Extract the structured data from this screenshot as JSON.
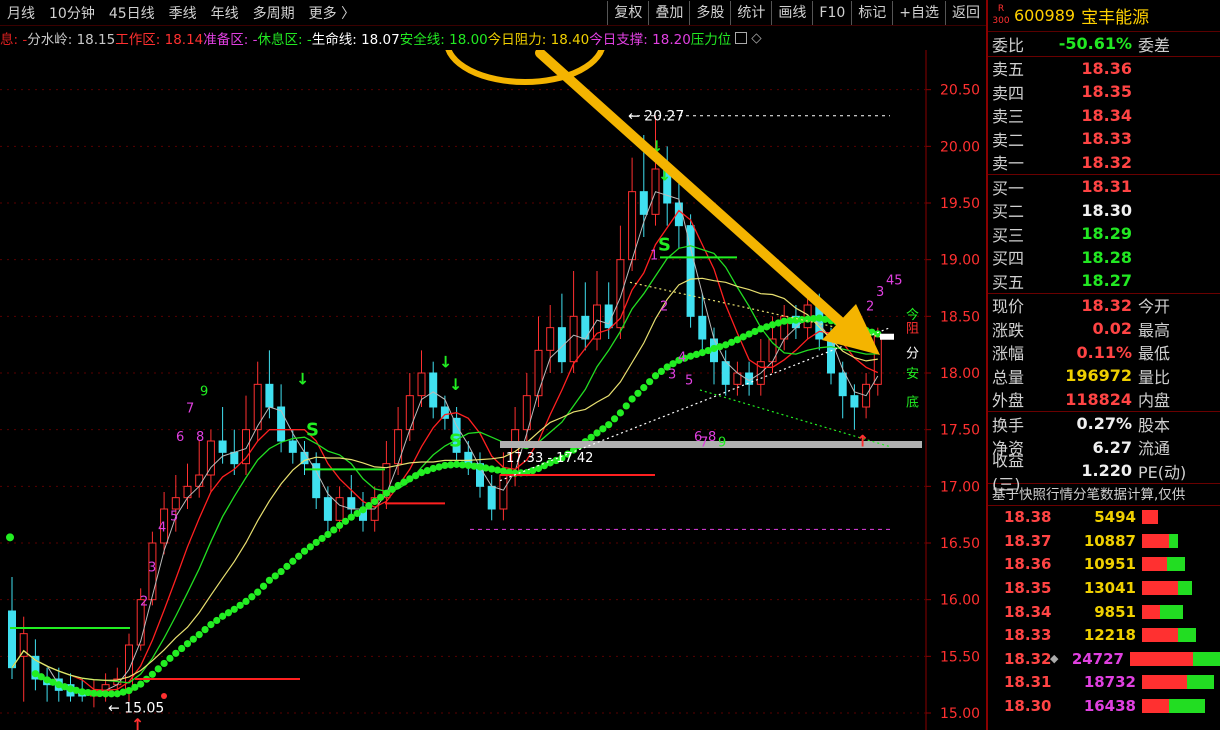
{
  "toolbar": {
    "periods": [
      "月线",
      "10分钟",
      "45日线",
      "季线",
      "年线",
      "多周期",
      "更多 〉"
    ],
    "tools": [
      "复权",
      "叠加",
      "多股",
      "统计",
      "画线",
      "F10",
      "标记",
      "+自选",
      "返回"
    ]
  },
  "indicators": [
    {
      "label": "息:",
      "value": "-",
      "color": "#dd2020"
    },
    {
      "label": "分水岭:",
      "value": "18.15",
      "color": "#c8c8c8"
    },
    {
      "label": "工作区:",
      "value": "18.14",
      "color": "#ff3030"
    },
    {
      "label": "准备区:",
      "value": "-",
      "color": "#e040e0"
    },
    {
      "label": "休息区:",
      "value": "-",
      "color": "#22e822"
    },
    {
      "label": "生命线:",
      "value": "18.07",
      "color": "#ffffff"
    },
    {
      "label": "安全线:",
      "value": "18.00",
      "color": "#22e822"
    },
    {
      "label": "今日阻力:",
      "value": "18.40",
      "color": "#f0d000"
    },
    {
      "label": "今日支撑:",
      "value": "18.20",
      "color": "#e040e0"
    },
    {
      "label": "压力位",
      "value": "",
      "color": "#22e822"
    }
  ],
  "chart_data": {
    "type": "candlestick",
    "ylim": [
      14.85,
      20.85
    ],
    "y_ticks": [
      "20.50",
      "20.00",
      "19.50",
      "19.00",
      "18.50",
      "18.00",
      "17.50",
      "17.00",
      "16.50",
      "16.00",
      "15.50",
      "15.00"
    ],
    "annotations": {
      "high": "20.27",
      "low": "15.05",
      "range": "17.33 - 17.42",
      "side_labels": [
        "今",
        "阻",
        "分",
        "安",
        "底"
      ]
    },
    "candles": [
      [
        15.9,
        15.4,
        16.2,
        15.3
      ],
      [
        15.5,
        15.7,
        15.85,
        15.1
      ],
      [
        15.5,
        15.3,
        15.65,
        15.2
      ],
      [
        15.3,
        15.25,
        15.4,
        15.1
      ],
      [
        15.3,
        15.2,
        15.4,
        15.1
      ],
      [
        15.25,
        15.15,
        15.35,
        15.1
      ],
      [
        15.2,
        15.15,
        15.3,
        15.1
      ],
      [
        15.15,
        15.2,
        15.3,
        15.05
      ],
      [
        15.2,
        15.25,
        15.35,
        15.1
      ],
      [
        15.25,
        15.3,
        15.4,
        15.15
      ],
      [
        15.2,
        15.6,
        15.7,
        15.1
      ],
      [
        15.6,
        16.0,
        16.1,
        15.55
      ],
      [
        16.0,
        16.5,
        16.6,
        15.95
      ],
      [
        16.5,
        16.8,
        16.95,
        16.4
      ],
      [
        16.8,
        16.9,
        17.1,
        16.6
      ],
      [
        16.9,
        17.0,
        17.2,
        16.8
      ],
      [
        17.0,
        17.1,
        17.4,
        16.9
      ],
      [
        17.1,
        17.4,
        17.5,
        16.95
      ],
      [
        17.4,
        17.3,
        17.7,
        17.2
      ],
      [
        17.3,
        17.2,
        17.5,
        17.1
      ],
      [
        17.2,
        17.5,
        17.8,
        17.1
      ],
      [
        17.5,
        17.9,
        18.1,
        17.4
      ],
      [
        17.9,
        17.7,
        18.2,
        17.6
      ],
      [
        17.7,
        17.4,
        17.9,
        17.3
      ],
      [
        17.4,
        17.3,
        17.5,
        17.2
      ],
      [
        17.3,
        17.2,
        17.4,
        17.1
      ],
      [
        17.2,
        16.9,
        17.3,
        16.8
      ],
      [
        16.9,
        16.7,
        17.0,
        16.6
      ],
      [
        16.7,
        16.9,
        17.0,
        16.6
      ],
      [
        16.9,
        16.8,
        17.1,
        16.7
      ],
      [
        16.8,
        16.7,
        16.95,
        16.6
      ],
      [
        16.7,
        16.9,
        17.0,
        16.6
      ],
      [
        16.9,
        17.2,
        17.4,
        16.8
      ],
      [
        17.2,
        17.5,
        17.7,
        17.1
      ],
      [
        17.5,
        17.8,
        18.0,
        17.4
      ],
      [
        17.8,
        18.0,
        18.2,
        17.7
      ],
      [
        18.0,
        17.7,
        18.1,
        17.6
      ],
      [
        17.7,
        17.6,
        17.8,
        17.5
      ],
      [
        17.6,
        17.3,
        17.7,
        17.2
      ],
      [
        17.3,
        17.2,
        17.4,
        17.1
      ],
      [
        17.2,
        17.0,
        17.3,
        16.9
      ],
      [
        17.0,
        16.8,
        17.1,
        16.7
      ],
      [
        16.8,
        17.1,
        17.3,
        16.7
      ],
      [
        17.1,
        17.5,
        17.7,
        17.0
      ],
      [
        17.5,
        17.8,
        18.0,
        17.4
      ],
      [
        17.8,
        18.2,
        18.5,
        17.7
      ],
      [
        18.2,
        18.4,
        18.6,
        18.0
      ],
      [
        18.4,
        18.1,
        18.7,
        18.0
      ],
      [
        18.1,
        18.5,
        18.9,
        18.0
      ],
      [
        18.5,
        18.3,
        18.8,
        18.2
      ],
      [
        18.3,
        18.6,
        18.9,
        18.2
      ],
      [
        18.6,
        18.4,
        18.8,
        18.3
      ],
      [
        18.4,
        19.0,
        19.3,
        18.3
      ],
      [
        19.0,
        19.6,
        19.9,
        18.9
      ],
      [
        19.6,
        19.4,
        20.1,
        19.2
      ],
      [
        19.4,
        19.8,
        20.27,
        19.3
      ],
      [
        19.8,
        19.5,
        20.0,
        19.3
      ],
      [
        19.5,
        19.3,
        19.7,
        19.1
      ],
      [
        19.3,
        18.5,
        19.4,
        18.4
      ],
      [
        18.5,
        18.3,
        18.7,
        18.2
      ],
      [
        18.3,
        18.1,
        18.4,
        17.9
      ],
      [
        18.1,
        17.9,
        18.2,
        17.8
      ],
      [
        17.9,
        18.0,
        18.1,
        17.8
      ],
      [
        18.0,
        17.9,
        18.1,
        17.8
      ],
      [
        17.9,
        18.1,
        18.3,
        17.8
      ],
      [
        18.1,
        18.3,
        18.5,
        18.0
      ],
      [
        18.3,
        18.5,
        18.6,
        18.2
      ],
      [
        18.5,
        18.4,
        18.6,
        18.3
      ],
      [
        18.4,
        18.6,
        18.7,
        18.3
      ],
      [
        18.6,
        18.3,
        18.7,
        18.2
      ],
      [
        18.3,
        18.0,
        18.4,
        17.9
      ],
      [
        18.0,
        17.8,
        18.1,
        17.6
      ],
      [
        17.8,
        17.7,
        17.9,
        17.5
      ],
      [
        17.7,
        17.9,
        18.0,
        17.6
      ],
      [
        17.9,
        18.32,
        18.4,
        17.8
      ]
    ]
  },
  "quote": {
    "header": {
      "r_label": "R",
      "index_label": "300",
      "code": "600989",
      "name": "宝丰能源"
    },
    "ratio": {
      "label": "委比",
      "value": "-50.61%",
      "label2": "委差"
    },
    "asks": [
      {
        "label": "卖五",
        "price": "18.36"
      },
      {
        "label": "卖四",
        "price": "18.35"
      },
      {
        "label": "卖三",
        "price": "18.34"
      },
      {
        "label": "卖二",
        "price": "18.33"
      },
      {
        "label": "卖一",
        "price": "18.32"
      }
    ],
    "bids": [
      {
        "label": "买一",
        "price": "18.31",
        "color": "#ff4444"
      },
      {
        "label": "买二",
        "price": "18.30",
        "color": "#f0f0f0"
      },
      {
        "label": "买三",
        "price": "18.29",
        "color": "#22e822"
      },
      {
        "label": "买四",
        "price": "18.28",
        "color": "#22e822"
      },
      {
        "label": "买五",
        "price": "18.27",
        "color": "#22e822"
      }
    ],
    "stats": [
      {
        "label": "现价",
        "value": "18.32",
        "color": "#ff4444",
        "label2": "今开"
      },
      {
        "label": "涨跌",
        "value": "0.02",
        "color": "#ff4444",
        "label2": "最高"
      },
      {
        "label": "涨幅",
        "value": "0.11%",
        "color": "#ff4444",
        "label2": "最低"
      },
      {
        "label": "总量",
        "value": "196972",
        "color": "#f0d000",
        "label2": "量比"
      },
      {
        "label": "外盘",
        "value": "118824",
        "color": "#ff4444",
        "label2": "内盘"
      }
    ],
    "stats2": [
      {
        "label": "换手",
        "value": "0.27%",
        "color": "#f0f0f0",
        "label2": "股本"
      },
      {
        "label": "净资",
        "value": "6.27",
        "color": "#f0f0f0",
        "label2": "流通"
      },
      {
        "label": "收益(三)",
        "value": "1.220",
        "color": "#f0f0f0",
        "label2": "PE(动)"
      }
    ],
    "tick_caption": "基于快照行情分笔数据计算,仅供",
    "price_levels": [
      {
        "price": "18.38",
        "volume": "5494",
        "vcolor": "#f0d000",
        "red": 0.18,
        "green": 0.0
      },
      {
        "price": "18.37",
        "volume": "10887",
        "vcolor": "#f0d000",
        "red": 0.3,
        "green": 0.1
      },
      {
        "price": "18.36",
        "volume": "10951",
        "vcolor": "#f0d000",
        "red": 0.28,
        "green": 0.2
      },
      {
        "price": "18.35",
        "volume": "13041",
        "vcolor": "#f0d000",
        "red": 0.4,
        "green": 0.15
      },
      {
        "price": "18.34",
        "volume": "9851",
        "vcolor": "#f0d000",
        "red": 0.2,
        "green": 0.25
      },
      {
        "price": "18.33",
        "volume": "12218",
        "vcolor": "#f0d000",
        "red": 0.4,
        "green": 0.2
      },
      {
        "price": "18.32",
        "volume": "24727",
        "vcolor": "#e040e0",
        "red": 0.7,
        "green": 0.3,
        "marked": true
      },
      {
        "price": "18.31",
        "volume": "18732",
        "vcolor": "#e040e0",
        "red": 0.5,
        "green": 0.3
      },
      {
        "price": "18.30",
        "volume": "16438",
        "vcolor": "#e040e0",
        "red": 0.3,
        "green": 0.4
      }
    ]
  }
}
